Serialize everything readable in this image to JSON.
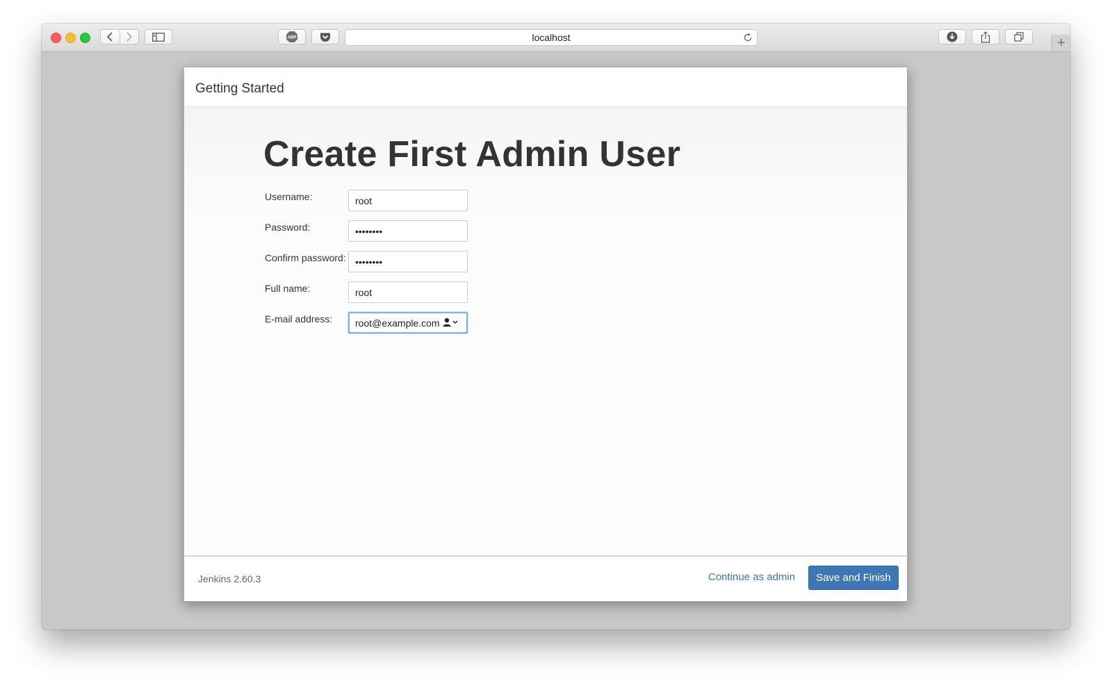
{
  "browser": {
    "address": "localhost",
    "new_tab_symbol": "+",
    "icons": [
      "back-icon",
      "forward-icon",
      "sidebar-icon",
      "adblock-icon",
      "pocket-icon",
      "reload-icon",
      "download-icon",
      "share-icon",
      "tabs-icon"
    ]
  },
  "dialog": {
    "header_title": "Getting Started",
    "heading": "Create First Admin User",
    "fields": {
      "username": {
        "label": "Username:",
        "value": "root"
      },
      "password": {
        "label": "Password:",
        "value": "12345678"
      },
      "confirm_password": {
        "label": "Confirm password:",
        "value": "12345678"
      },
      "full_name": {
        "label": "Full name:",
        "value": "root"
      },
      "email": {
        "label": "E-mail address:",
        "value": "root@example.com"
      }
    },
    "footer": {
      "version": "Jenkins 2.60.3",
      "continue_label": "Continue as admin",
      "save_label": "Save and Finish"
    }
  },
  "colors": {
    "primary_button": "#3e77b5",
    "link": "#3774b8",
    "focus_ring": "#7ab1ea"
  }
}
